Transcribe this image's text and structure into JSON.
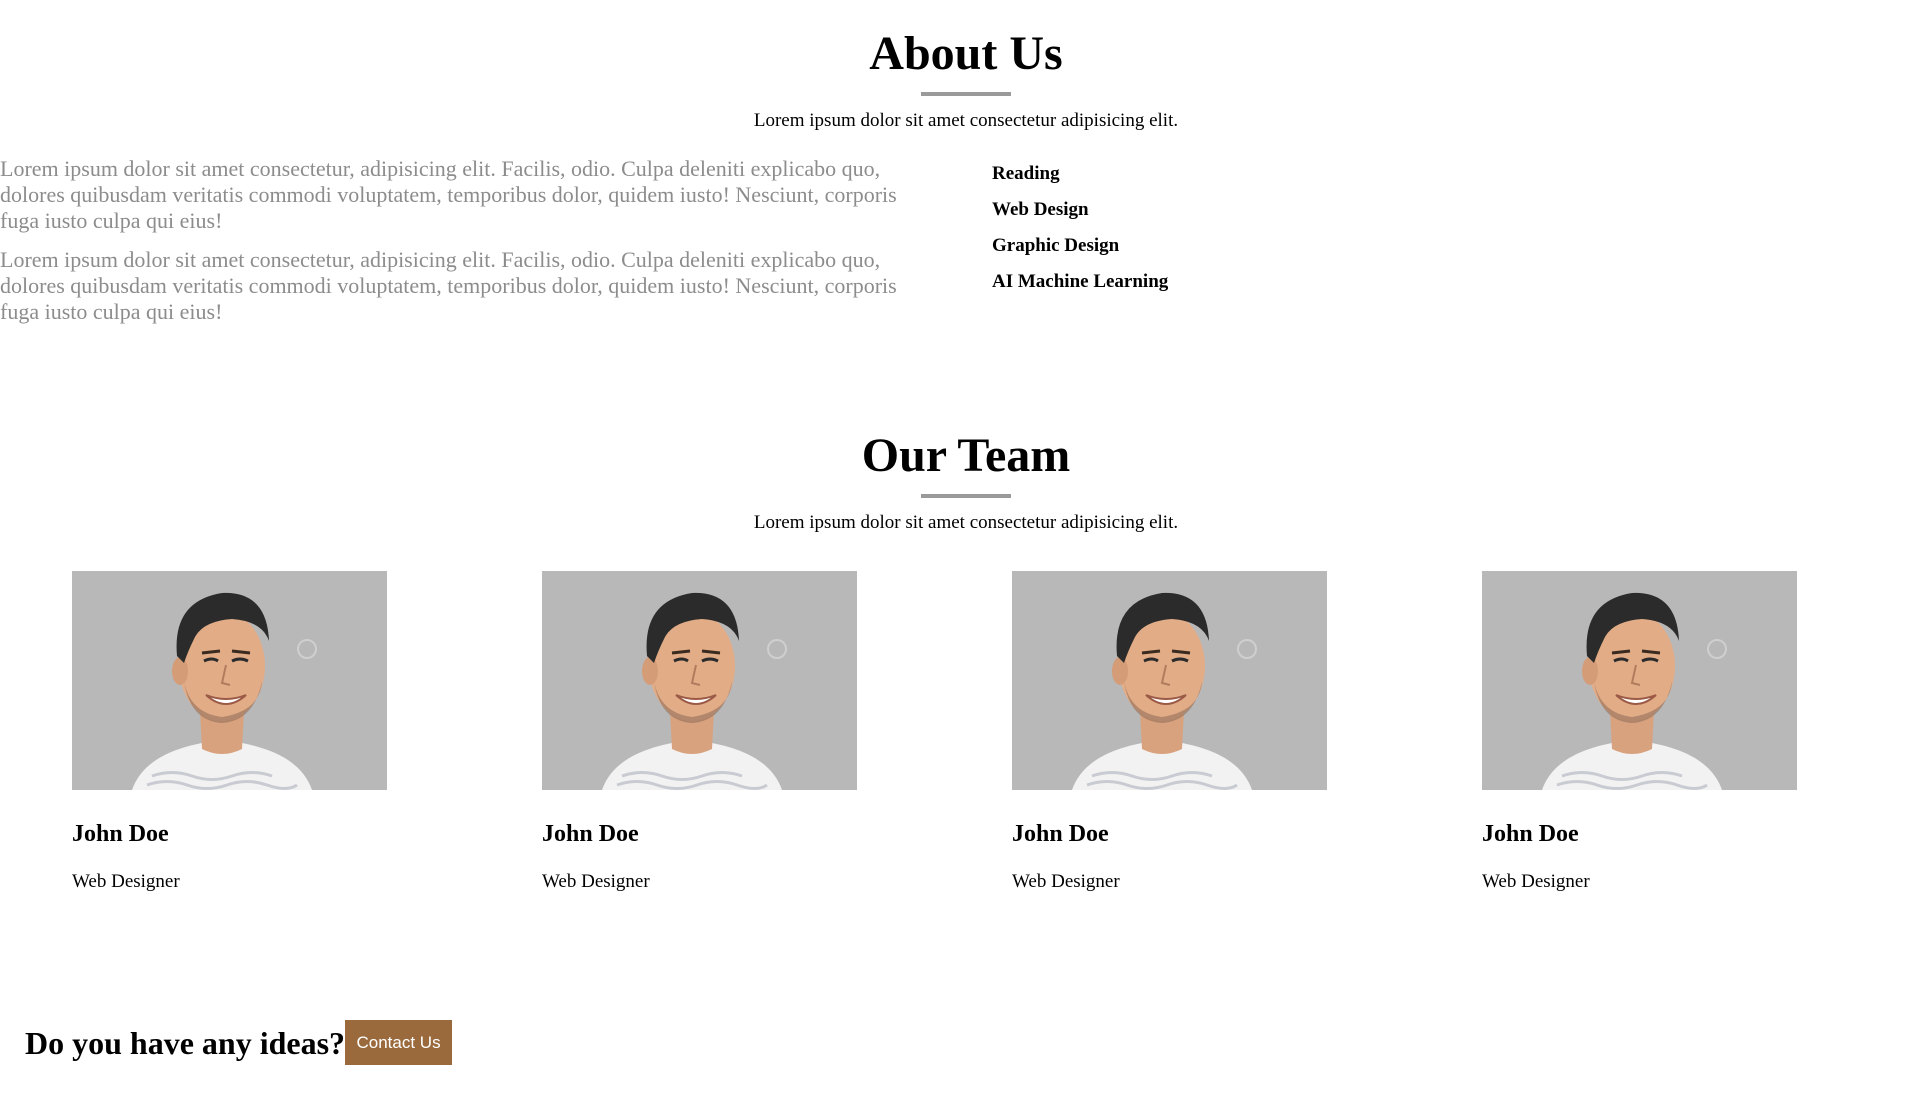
{
  "about": {
    "title": "About Us",
    "subtitle": "Lorem ipsum dolor sit amet consectetur adipisicing elit.",
    "paragraphs": [
      "Lorem ipsum dolor sit amet consectetur, adipisicing elit. Facilis, odio. Culpa deleniti explicabo quo, dolores quibusdam veritatis commodi voluptatem, temporibus dolor, quidem iusto! Nesciunt, corporis fuga iusto culpa qui eius!",
      "Lorem ipsum dolor sit amet consectetur, adipisicing elit. Facilis, odio. Culpa deleniti explicabo quo, dolores quibusdam veritatis commodi voluptatem, temporibus dolor, quidem iusto! Nesciunt, corporis fuga iusto culpa qui eius!"
    ],
    "interests": [
      "Reading",
      "Web Design",
      "Graphic Design",
      "AI Machine Learning"
    ]
  },
  "team": {
    "title": "Our Team",
    "subtitle": "Lorem ipsum dolor sit amet consectetur adipisicing elit.",
    "members": [
      {
        "name": "John Doe",
        "role": "Web Designer",
        "photo_icon": "smiling-man-portrait"
      },
      {
        "name": "John Doe",
        "role": "Web Designer",
        "photo_icon": "smiling-man-portrait"
      },
      {
        "name": "John Doe",
        "role": "Web Designer",
        "photo_icon": "smiling-man-portrait"
      },
      {
        "name": "John Doe",
        "role": "Web Designer",
        "photo_icon": "smiling-man-portrait"
      }
    ]
  },
  "cta": {
    "text": "Do you have any ideas?",
    "button_label": "Contact Us"
  },
  "colors": {
    "accent_button": "#9a6a3d",
    "rule": "#9a9a9a",
    "muted_text": "#8c8c8c",
    "photo_bg": "#b8b8b8"
  }
}
